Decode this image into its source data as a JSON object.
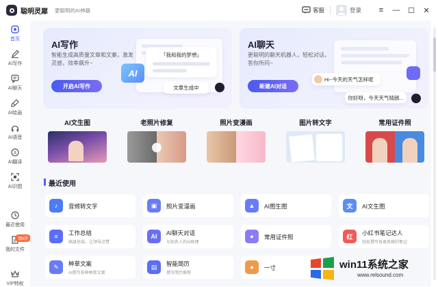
{
  "app": {
    "name": "聪明灵犀",
    "slogan": "更聪明的AI神器"
  },
  "topbar": {
    "service_label": "客服",
    "login_label": "登录"
  },
  "window_controls": {
    "menu": "≡",
    "minimize": "—",
    "maximize": "☐",
    "close": "✕"
  },
  "sidebar": {
    "items": [
      {
        "label": "首页",
        "icon": "home-icon"
      },
      {
        "label": "AI写作",
        "icon": "pen-icon"
      },
      {
        "label": "AI聊天",
        "icon": "chat-icon"
      },
      {
        "label": "AI绘画",
        "icon": "brush-icon"
      },
      {
        "label": "AI语音",
        "icon": "headphone-icon"
      },
      {
        "label": "AI翻译",
        "icon": "translate-icon"
      },
      {
        "label": "AI识图",
        "icon": "scan-icon"
      },
      {
        "label": "最近使用",
        "icon": "clock-icon"
      },
      {
        "label": "我的文件",
        "icon": "file-icon"
      },
      {
        "label": "VIP特权",
        "icon": "vip-icon"
      }
    ],
    "vip_badge": "领8折"
  },
  "cards": {
    "writing": {
      "title": "AI写作",
      "desc": "智能生成高质量文章和文案，激发灵感，效率飙升~",
      "button": "开启AI写作",
      "mock_quote": "「我和我的梦想」",
      "mock_status": "文章生成中",
      "mock_ai": "AI"
    },
    "chat": {
      "title": "AI聊天",
      "desc": "更聪明的聊天机器人，轻松对话，答你所问~",
      "button": "新建AI对话",
      "bubble_q": "Hi~今天的天气怎样呢",
      "bubble_a": "你好呀，今天天气晴朗..."
    }
  },
  "tools": [
    {
      "label": "AI文生图"
    },
    {
      "label": "老照片修复"
    },
    {
      "label": "照片变漫画"
    },
    {
      "label": "图片转文字"
    },
    {
      "label": "常用证件照"
    }
  ],
  "recent": {
    "title": "最近使用",
    "items": [
      {
        "name": "音频转文字",
        "sub": "",
        "icon": "waveform-icon",
        "color": "#4d7cf3"
      },
      {
        "name": "照片变漫画",
        "sub": "",
        "icon": "photo-icon",
        "color": "#6a7cf5"
      },
      {
        "name": "AI图生图",
        "sub": "",
        "icon": "image-icon",
        "color": "#6a7cf5"
      },
      {
        "name": "AI文生图",
        "sub": "",
        "icon": "text-image-icon",
        "color": "#5b8ef5"
      },
      {
        "name": "工作总结",
        "sub": "高级总结，让领导点赞",
        "icon": "doc-icon",
        "color": "#5b6ef5"
      },
      {
        "name": "AI聊天对话",
        "sub": "与知名人的AI助理",
        "icon": "chat-bubble-icon",
        "color": "#6a6ef5"
      },
      {
        "name": "常用证件照",
        "sub": "",
        "icon": "id-photo-icon",
        "color": "#8a7cf5"
      },
      {
        "name": "小红书笔记达人",
        "sub": "轻松撰写各类风格的笔记",
        "icon": "note-icon",
        "color": "#f05a5a"
      },
      {
        "name": "种草文案",
        "sub": "AI撰写各种种草文案",
        "icon": "leaf-icon",
        "color": "#6a7cf5"
      },
      {
        "name": "智能简历",
        "sub": "撰写简历推荐",
        "icon": "resume-icon",
        "color": "#5b6ef5"
      },
      {
        "name": "一寸",
        "sub": "",
        "icon": "portrait-icon",
        "color": "#f09a4a"
      }
    ]
  },
  "watermark": {
    "title": "win11系统之家",
    "url": "www.relsound.com"
  }
}
